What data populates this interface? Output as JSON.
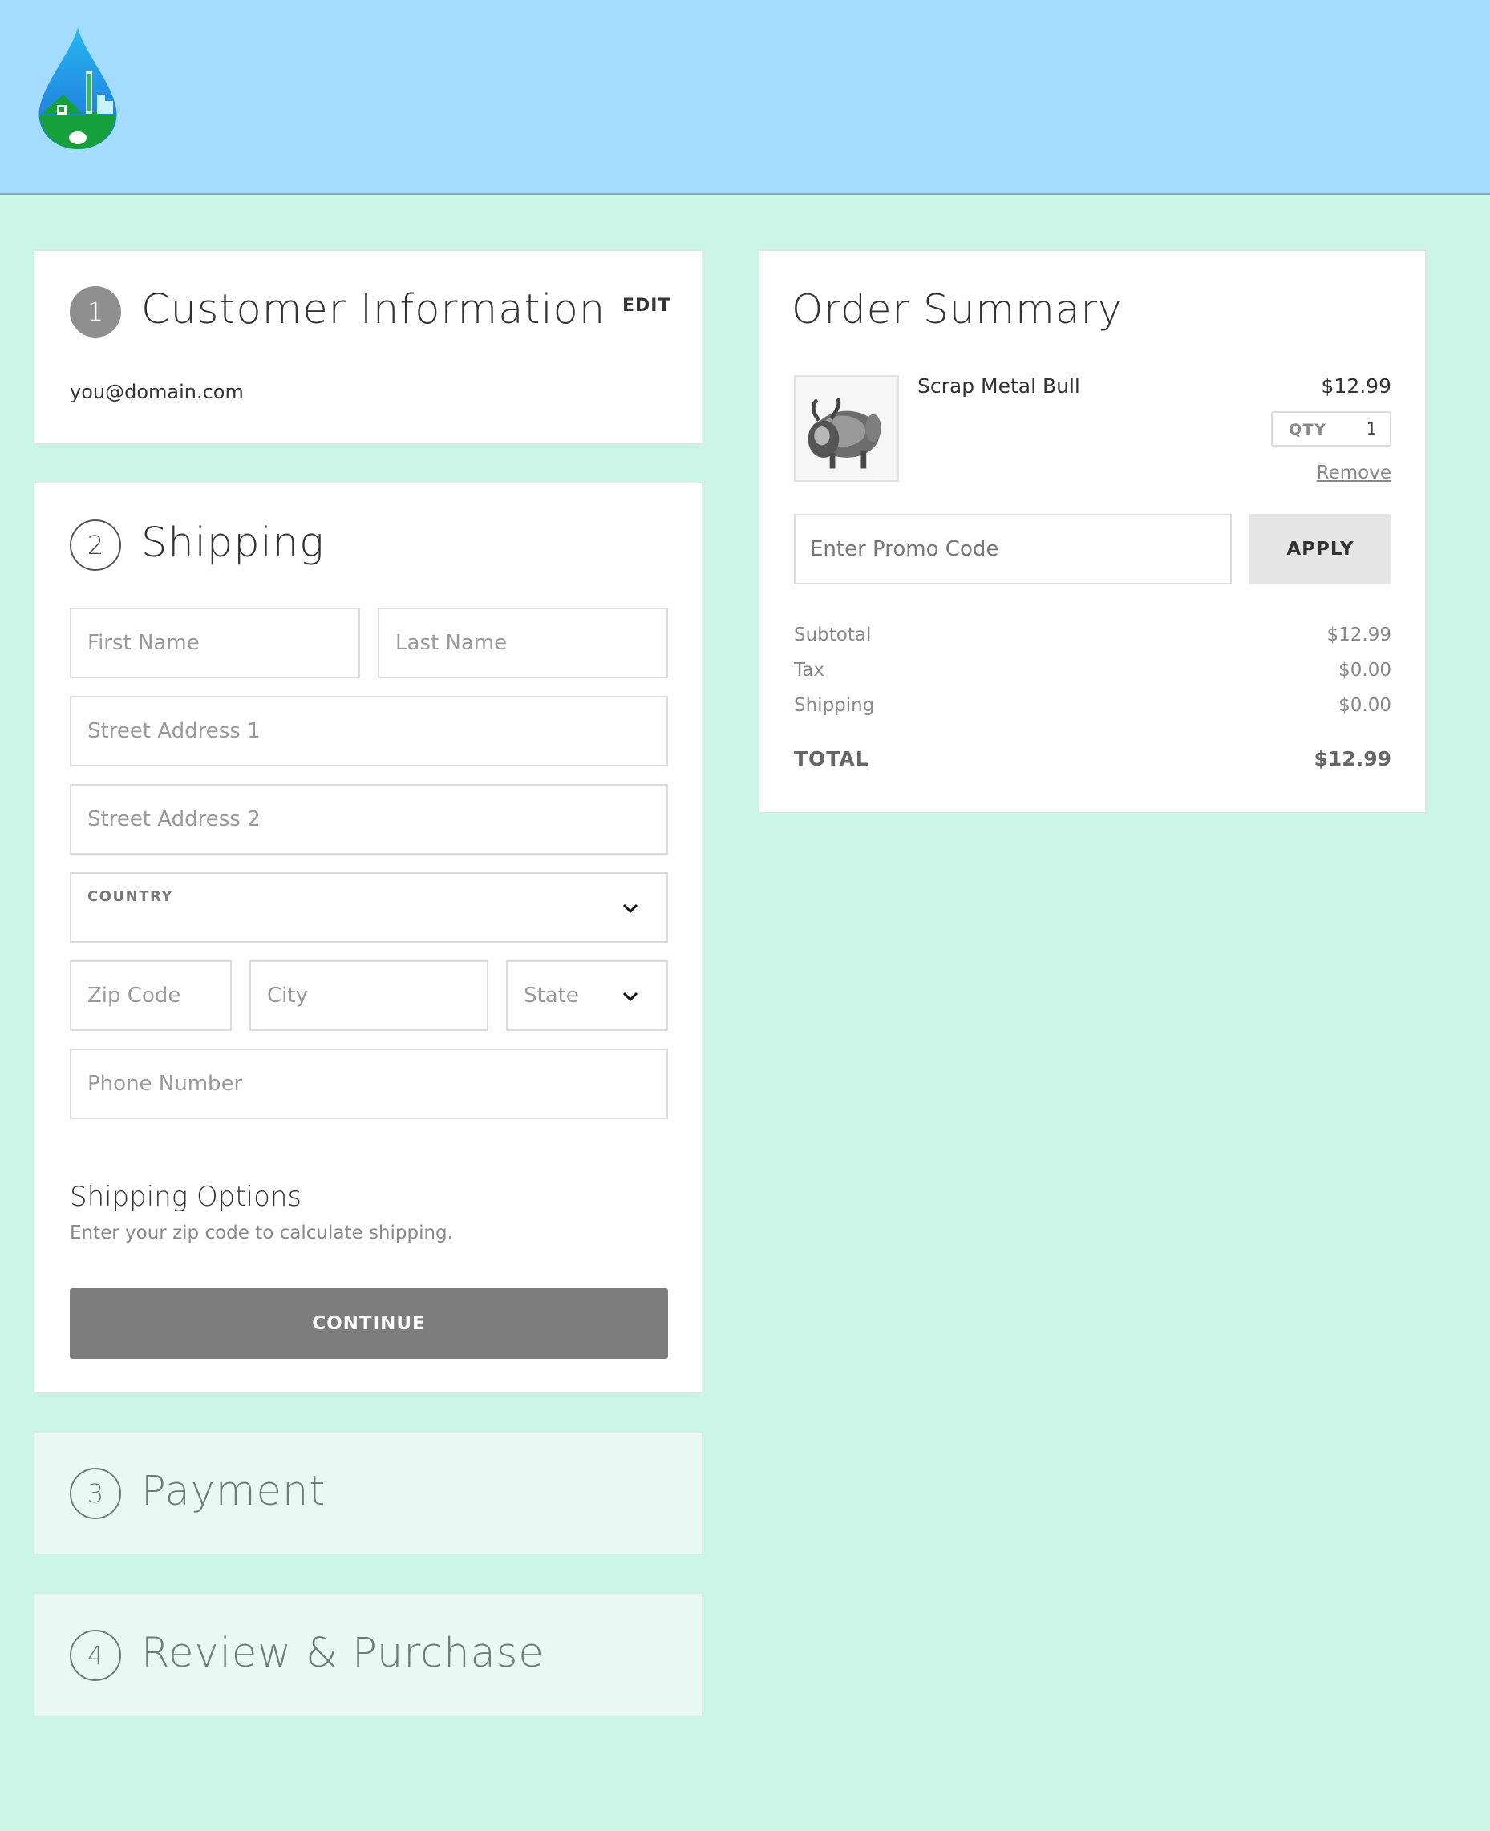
{
  "header": {
    "logo_icon": "water-drop-house-logo",
    "background": "#a4dcfd"
  },
  "page_background": "#cbf5e7",
  "customer_info": {
    "step": "1",
    "title": "Customer Information",
    "edit_label": "EDIT",
    "email": "you@domain.com"
  },
  "shipping": {
    "step": "2",
    "title": "Shipping",
    "first_name_placeholder": "First Name",
    "last_name_placeholder": "Last Name",
    "street1_placeholder": "Street Address 1",
    "street2_placeholder": "Street Address 2",
    "country_label": "COUNTRY",
    "zip_placeholder": "Zip Code",
    "city_placeholder": "City",
    "state_label": "State",
    "phone_placeholder": "Phone Number",
    "options_title": "Shipping Options",
    "options_hint": "Enter your zip code to calculate shipping.",
    "continue_label": "CONTINUE"
  },
  "payment": {
    "step": "3",
    "title": "Payment"
  },
  "review": {
    "step": "4",
    "title": "Review & Purchase"
  },
  "order_summary": {
    "title": "Order Summary",
    "item": {
      "name": "Scrap Metal Bull",
      "price": "$12.99",
      "qty_label": "QTY",
      "qty": "1",
      "remove_label": "Remove",
      "thumb_icon": "metal-bull-image"
    },
    "promo_placeholder": "Enter Promo Code",
    "apply_label": "APPLY",
    "lines": [
      {
        "label": "Subtotal",
        "value": "$12.99"
      },
      {
        "label": "Tax",
        "value": "$0.00"
      },
      {
        "label": "Shipping",
        "value": "$0.00"
      }
    ],
    "total_label": "TOTAL",
    "total_value": "$12.99"
  }
}
